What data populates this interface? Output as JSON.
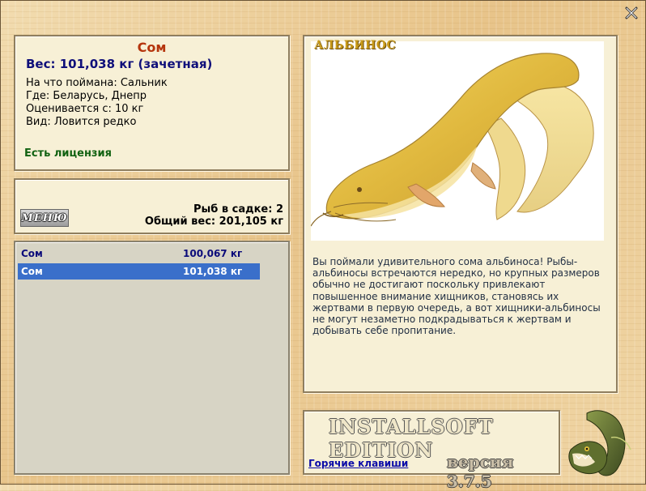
{
  "window": {
    "close_label": "X"
  },
  "fish_info": {
    "name": "Сом",
    "weight": "Вес: 101,038 кг (зачетная)",
    "bait": "На что поймана: Сальник",
    "location": "Где: Беларусь, Днепр",
    "rated_from": "Оценивается с: 10 кг",
    "species": "Вид: Ловится редко",
    "license": "Есть лицензия"
  },
  "cage": {
    "menu_label": "МЕНЮ",
    "fish_count": "Рыб в садке: 2",
    "total_weight": "Общий вес: 201,105 кг"
  },
  "catch_list": [
    {
      "name": "Сом",
      "weight": "100,067 кг",
      "selected": false
    },
    {
      "name": "Сом",
      "weight": "101,038 кг",
      "selected": true
    }
  ],
  "photo": {
    "badge": "АЛЬБИНОС",
    "description": "Вы поймали удивительного сома альбиноса! Рыбы-альбиносы встречаются нередко, но крупных размеров обычно не достигают поскольку привлекают повышенное внимание хищников, становясь их жертвами в первую очередь, а вот хищники-альбиносы не могут незаметно подкрадываться к жертвам и добывать себе пропитание."
  },
  "footer": {
    "edition": "INSTALLSOFT EDITION",
    "hotkeys_link": "Горячие клавиши",
    "version": "версия 3.7.5"
  },
  "icons": {
    "close": "close-icon",
    "catfish": "catfish-image",
    "pike": "pike-logo"
  }
}
